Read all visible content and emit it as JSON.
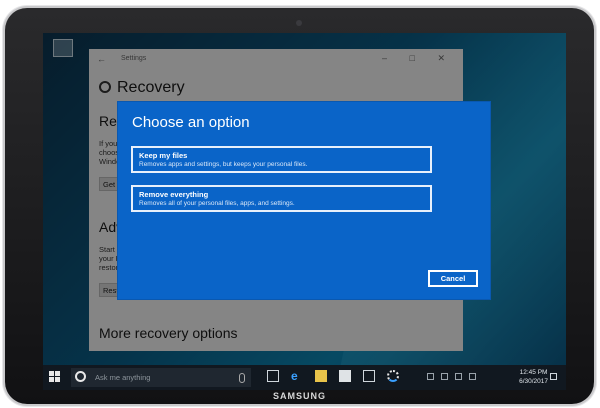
{
  "device": {
    "brand": "SAMSUNG"
  },
  "settings_window": {
    "title": "Settings",
    "back_glyph": "←",
    "controls": "–  □  ✕",
    "page_title": "Recovery",
    "sections": [
      {
        "heading": "Reset this PC",
        "lines": [
          "If you",
          "choose",
          "Windo"
        ],
        "button": "Get"
      },
      {
        "heading": "Advanced startup",
        "lines": [
          "Start",
          "your P",
          "restor"
        ],
        "button": "Rest"
      }
    ],
    "more_heading": "More recovery options"
  },
  "dialog": {
    "title": "Choose an option",
    "options": [
      {
        "title": "Keep my files",
        "description": "Removes apps and settings, but keeps your personal files."
      },
      {
        "title": "Remove everything",
        "description": "Removes all of your personal files, apps, and settings."
      }
    ],
    "cancel_label": "Cancel"
  },
  "taskbar": {
    "search_placeholder": "Ask me anything",
    "time": "12:45 PM",
    "date": "6/30/2017",
    "icons": [
      "task-view-icon",
      "edge-icon",
      "file-explorer-icon",
      "store-icon",
      "mail-icon",
      "settings-icon"
    ]
  },
  "colors": {
    "dialog_bg": "#0a64c8",
    "desktop": "#0a5d86",
    "taskbar": "#111820"
  }
}
